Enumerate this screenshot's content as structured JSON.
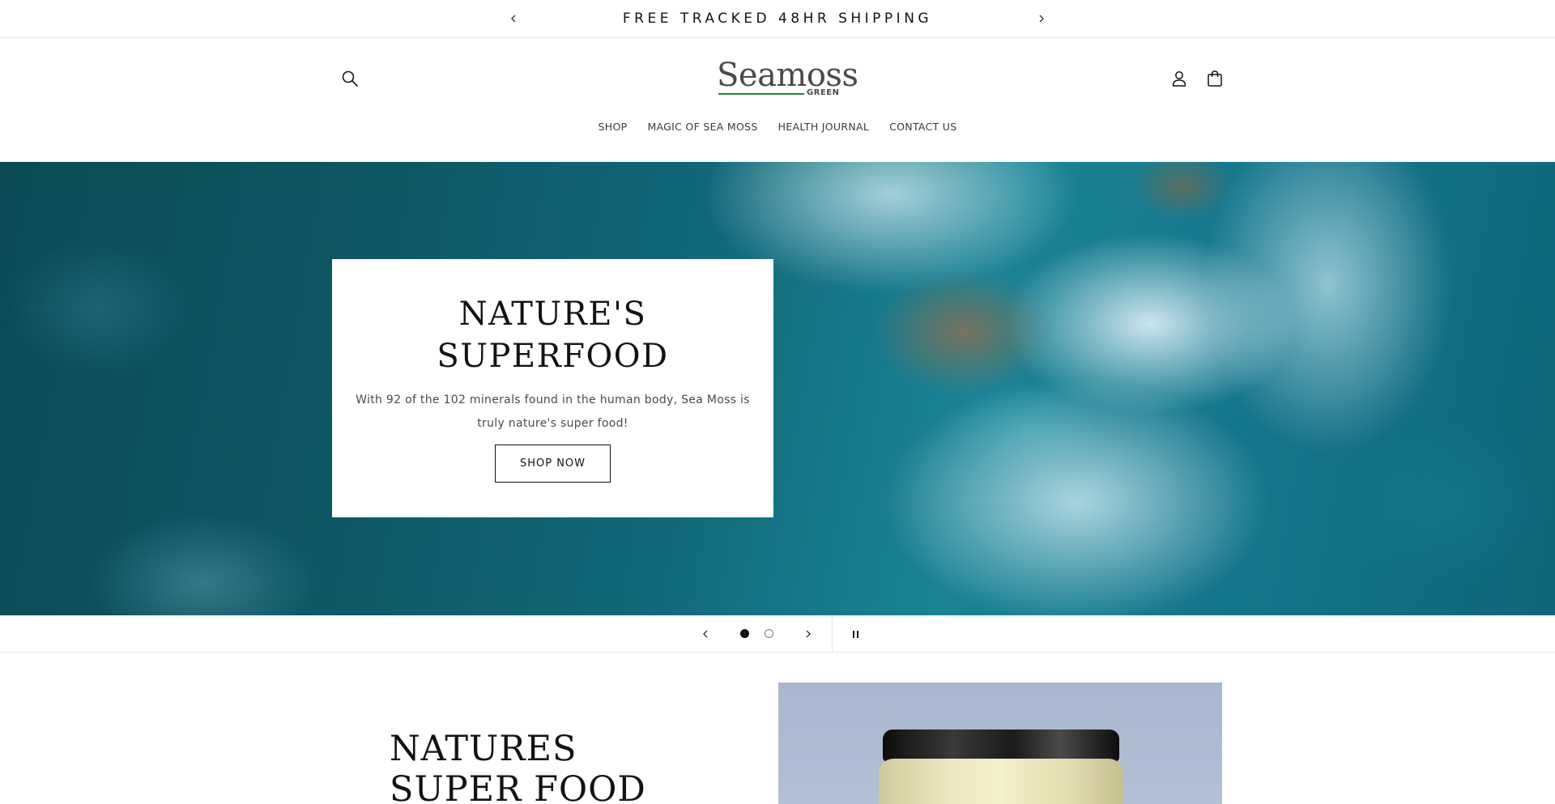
{
  "announcement": {
    "text": "FREE TRACKED 48HR SHIPPING",
    "prev_icon": "chevron-left-icon",
    "next_icon": "chevron-right-icon"
  },
  "header": {
    "logo": {
      "word": "Seamoss",
      "sub": "GREEN",
      "accent_color": "#2f7d3a"
    },
    "icons": [
      "search-icon",
      "account-icon",
      "cart-icon"
    ]
  },
  "nav": {
    "items": [
      {
        "label": "SHOP"
      },
      {
        "label": "MAGIC OF SEA MOSS"
      },
      {
        "label": "HEALTH JOURNAL"
      },
      {
        "label": "CONTACT US"
      }
    ]
  },
  "hero": {
    "title_line1": "NATURE'S",
    "title_line2": "SUPERFOOD",
    "text": "With 92 of the 102 minerals found in the human body, Sea Moss is truly nature's super food!",
    "button": "SHOP NOW"
  },
  "slider": {
    "slide_count": 2,
    "active_slide": 1,
    "controls": [
      "chevron-left-icon",
      "chevron-right-icon",
      "pause-icon"
    ]
  },
  "feature": {
    "title": "NATURES SUPER FOOD"
  },
  "colors": {
    "text": "#121212",
    "border": "#e6e6e6",
    "ocean": "#11697a"
  }
}
